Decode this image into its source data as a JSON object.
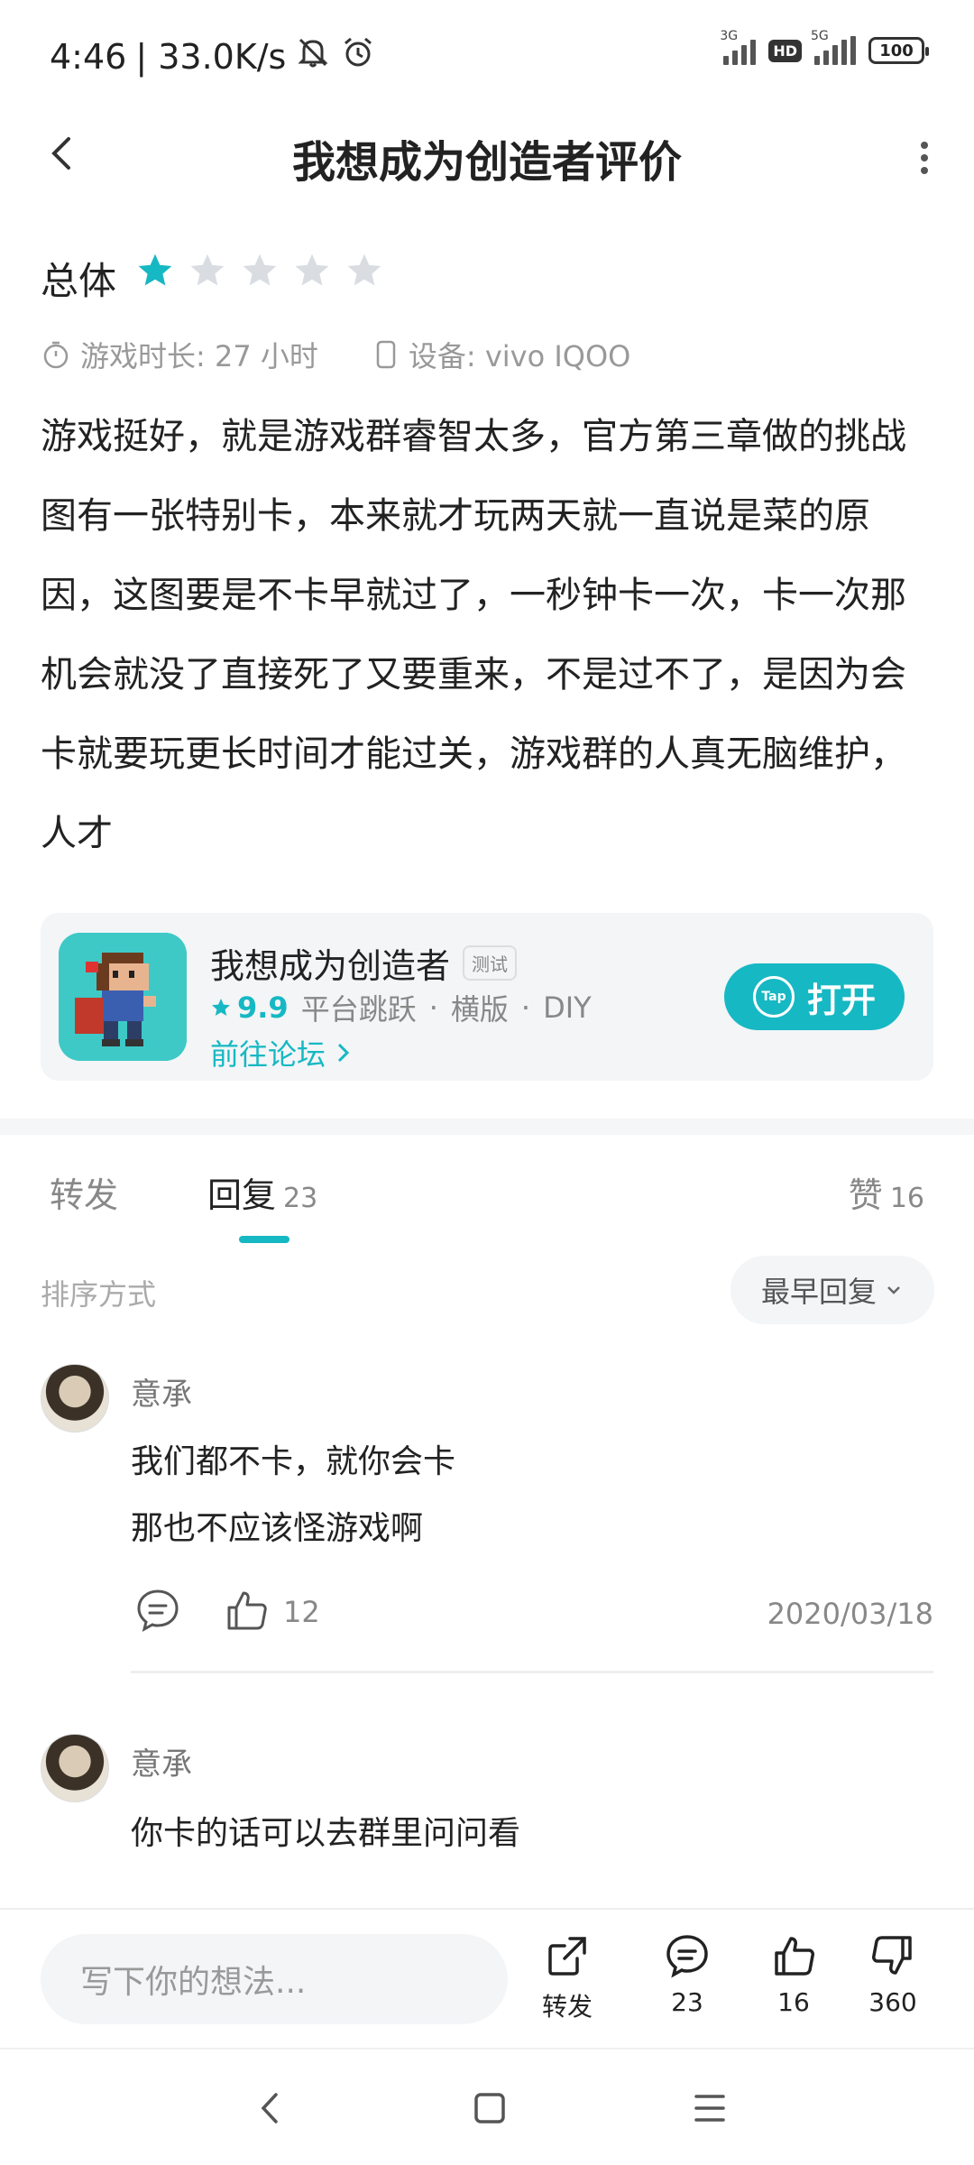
{
  "status_bar": {
    "time": "4:46",
    "speed": "| 33.0K/s",
    "net1": "3G",
    "net2": "5G",
    "hd": "HD",
    "battery": "100"
  },
  "header": {
    "title": "我想成为创造者评价"
  },
  "rating": {
    "label": "总体",
    "stars": 1,
    "max_stars": 5,
    "play_time": "游戏时长: 27 小时",
    "device": "设备: vivo IQOO"
  },
  "review_text": "游戏挺好，就是游戏群睿智太多，官方第三章做的挑战图有一张特别卡，本来就才玩两天就一直说是菜的原因，这图要是不卡早就过了，一秒钟卡一次，卡一次那机会就没了直接死了又要重来，不是过不了，是因为会卡就要玩更长时间才能过关，游戏群的人真无脑维护，人才",
  "app_card": {
    "name": "我想成为创造者",
    "tag": "测试",
    "score": "9.9",
    "tags": [
      "平台跳跃",
      "横版",
      "DIY"
    ],
    "dot": "·",
    "forum_link": "前往论坛",
    "open_button": "打开",
    "tap_badge": "Tap"
  },
  "tabs": {
    "forward": "转发",
    "reply": "回复",
    "reply_count": "23",
    "like": "赞",
    "like_count": "16"
  },
  "sort": {
    "label": "排序方式",
    "value": "最早回复"
  },
  "comments": [
    {
      "name": "意承",
      "lines": [
        "我们都不卡，就你会卡",
        "那也不应该怪游戏啊"
      ],
      "likes": "12",
      "date": "2020/03/18"
    },
    {
      "name": "意承",
      "lines": [
        "你卡的话可以去群里问问看"
      ]
    }
  ],
  "bottom_bar": {
    "placeholder": "写下你的想法...",
    "forward": "转发",
    "comments": "23",
    "likes": "16",
    "dislikes": "360"
  },
  "colors": {
    "accent": "#16b8c3",
    "star_off": "#d9dde2"
  }
}
